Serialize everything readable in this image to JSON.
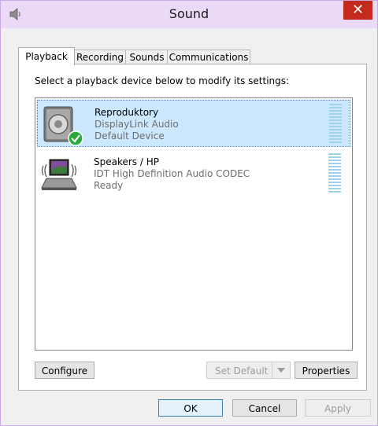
{
  "window": {
    "title": "Sound",
    "close_glyph": "✕"
  },
  "tabs": [
    {
      "label": "Playback",
      "active": true
    },
    {
      "label": "Recording",
      "active": false
    },
    {
      "label": "Sounds",
      "active": false
    },
    {
      "label": "Communications",
      "active": false
    }
  ],
  "playback": {
    "instruction": "Select a playback device below to modify its settings:",
    "devices": [
      {
        "name": "Reproduktory",
        "driver": "DisplayLink Audio",
        "status": "Default Device",
        "icon": "speaker-icon",
        "badge": "default-check-icon",
        "selected": true
      },
      {
        "name": "Speakers / HP",
        "driver": "IDT High Definition Audio CODEC",
        "status": "Ready",
        "icon": "laptop-speakers-icon",
        "selected": false
      }
    ]
  },
  "buttons": {
    "configure": "Configure",
    "set_default": "Set Default",
    "properties": "Properties",
    "ok": "OK",
    "cancel": "Cancel",
    "apply": "Apply"
  },
  "colors": {
    "titlebar": "#ead9f7",
    "close": "#c42b1c",
    "selection": "#cce8ff",
    "check": "#2aa83a"
  }
}
